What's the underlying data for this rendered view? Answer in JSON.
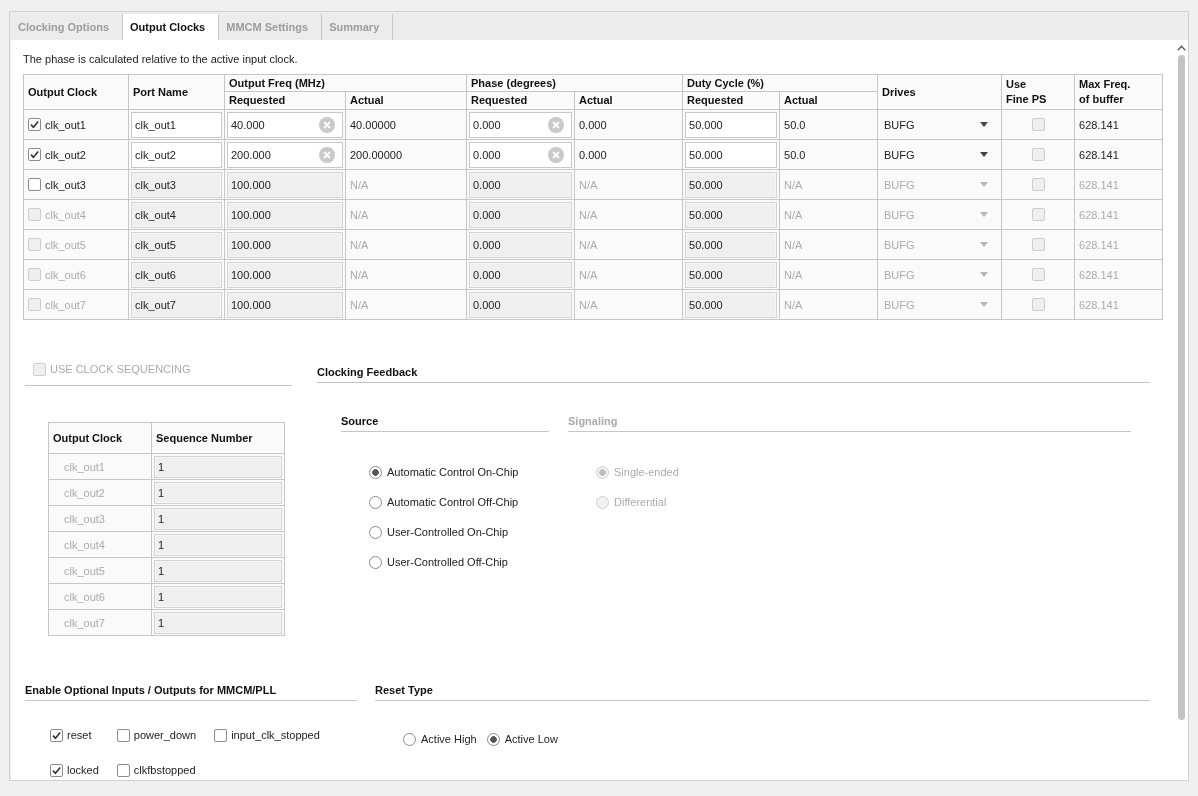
{
  "tabs": [
    {
      "label": "Clocking Options",
      "selected": false
    },
    {
      "label": "Output Clocks",
      "selected": true
    },
    {
      "label": "MMCM Settings",
      "selected": false
    },
    {
      "label": "Summary",
      "selected": false
    }
  ],
  "note": "The phase is calculated relative to the active input clock.",
  "output_table": {
    "columns": [
      {
        "label": "Output Clock"
      },
      {
        "label": "Port Name"
      },
      {
        "label": "Output Freq (MHz)",
        "subcolumns": [
          "Requested",
          "Actual"
        ]
      },
      {
        "label": "Phase (degrees)",
        "subcolumns": [
          "Requested",
          "Actual"
        ]
      },
      {
        "label": "Duty Cycle (%)",
        "subcolumns": [
          "Requested",
          "Actual"
        ]
      },
      {
        "label": "Drives"
      },
      {
        "lines": [
          "Use",
          "Fine PS"
        ]
      },
      {
        "lines": [
          "Max Freq.",
          "of buffer"
        ]
      }
    ],
    "rows": [
      {
        "clock": "clk_out1",
        "checked": true,
        "disabled": false,
        "port_name": "clk_out1",
        "freq_requested": "40.000",
        "freq_actual": "40.00000",
        "phase_requested": "0.000",
        "phase_actual": "0.000",
        "duty_requested": "50.000",
        "duty_actual": "50.0",
        "drives": "BUFG",
        "fine_ps": {
          "checked": false,
          "disabled": true
        },
        "max_freq": "628.141"
      },
      {
        "clock": "clk_out2",
        "checked": true,
        "disabled": false,
        "port_name": "clk_out2",
        "freq_requested": "200.000",
        "freq_actual": "200.00000",
        "phase_requested": "0.000",
        "phase_actual": "0.000",
        "duty_requested": "50.000",
        "duty_actual": "50.0",
        "drives": "BUFG",
        "fine_ps": {
          "checked": false,
          "disabled": true
        },
        "max_freq": "628.141"
      },
      {
        "clock": "clk_out3",
        "checked": false,
        "disabled": false,
        "port_name": "clk_out3",
        "freq_requested": "100.000",
        "freq_actual": "N/A",
        "phase_requested": "0.000",
        "phase_actual": "N/A",
        "duty_requested": "50.000",
        "duty_actual": "N/A",
        "drives": "BUFG",
        "fine_ps": {
          "checked": false,
          "disabled": true
        },
        "max_freq": "628.141"
      },
      {
        "clock": "clk_out4",
        "checked": false,
        "disabled": true,
        "port_name": "clk_out4",
        "freq_requested": "100.000",
        "freq_actual": "N/A",
        "phase_requested": "0.000",
        "phase_actual": "N/A",
        "duty_requested": "50.000",
        "duty_actual": "N/A",
        "drives": "BUFG",
        "fine_ps": {
          "checked": false,
          "disabled": true
        },
        "max_freq": "628.141"
      },
      {
        "clock": "clk_out5",
        "checked": false,
        "disabled": true,
        "port_name": "clk_out5",
        "freq_requested": "100.000",
        "freq_actual": "N/A",
        "phase_requested": "0.000",
        "phase_actual": "N/A",
        "duty_requested": "50.000",
        "duty_actual": "N/A",
        "drives": "BUFG",
        "fine_ps": {
          "checked": false,
          "disabled": true
        },
        "max_freq": "628.141"
      },
      {
        "clock": "clk_out6",
        "checked": false,
        "disabled": true,
        "port_name": "clk_out6",
        "freq_requested": "100.000",
        "freq_actual": "N/A",
        "phase_requested": "0.000",
        "phase_actual": "N/A",
        "duty_requested": "50.000",
        "duty_actual": "N/A",
        "drives": "BUFG",
        "fine_ps": {
          "checked": false,
          "disabled": true
        },
        "max_freq": "628.141"
      },
      {
        "clock": "clk_out7",
        "checked": false,
        "disabled": true,
        "port_name": "clk_out7",
        "freq_requested": "100.000",
        "freq_actual": "N/A",
        "phase_requested": "0.000",
        "phase_actual": "N/A",
        "duty_requested": "50.000",
        "duty_actual": "N/A",
        "drives": "BUFG",
        "fine_ps": {
          "checked": false,
          "disabled": true
        },
        "max_freq": "628.141"
      }
    ]
  },
  "sequencing": {
    "label": "USE CLOCK SEQUENCING",
    "checked": false,
    "disabled": true,
    "columns": [
      "Output Clock",
      "Sequence Number"
    ],
    "rows": [
      {
        "clock": "clk_out1",
        "sequence": "1"
      },
      {
        "clock": "clk_out2",
        "sequence": "1"
      },
      {
        "clock": "clk_out3",
        "sequence": "1"
      },
      {
        "clock": "clk_out4",
        "sequence": "1"
      },
      {
        "clock": "clk_out5",
        "sequence": "1"
      },
      {
        "clock": "clk_out6",
        "sequence": "1"
      },
      {
        "clock": "clk_out7",
        "sequence": "1"
      }
    ]
  },
  "feedback": {
    "title": "Clocking Feedback",
    "source": {
      "title": "Source",
      "options": [
        {
          "label": "Automatic Control On-Chip",
          "selected": true
        },
        {
          "label": "Automatic Control Off-Chip",
          "selected": false
        },
        {
          "label": "User-Controlled On-Chip",
          "selected": false
        },
        {
          "label": "User-Controlled Off-Chip",
          "selected": false
        }
      ]
    },
    "signaling": {
      "title": "Signaling",
      "disabled": true,
      "options": [
        {
          "label": "Single-ended",
          "selected": true
        },
        {
          "label": "Differential",
          "selected": false
        }
      ]
    }
  },
  "optional_ports": {
    "title": "Enable Optional Inputs / Outputs for MMCM/PLL",
    "items": [
      {
        "label": "reset",
        "checked": true
      },
      {
        "label": "power_down",
        "checked": false
      },
      {
        "label": "input_clk_stopped",
        "checked": false
      },
      {
        "label": "locked",
        "checked": true
      },
      {
        "label": "clkfbstopped",
        "checked": false
      }
    ]
  },
  "reset_type": {
    "title": "Reset Type",
    "options": [
      {
        "label": "Active High",
        "selected": false
      },
      {
        "label": "Active Low",
        "selected": true
      }
    ]
  }
}
